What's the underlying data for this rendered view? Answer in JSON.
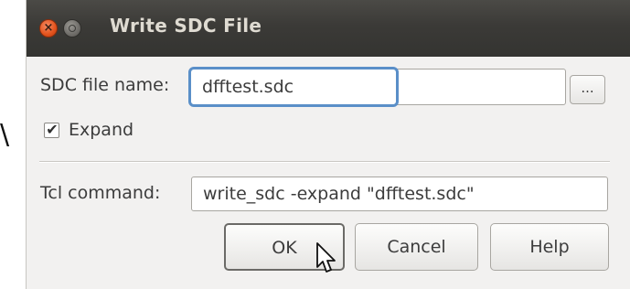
{
  "stray_glyph": "\\",
  "window": {
    "title": "Write SDC File",
    "close_glyph": "×"
  },
  "form": {
    "sdc_label": "SDC file name:",
    "sdc_value": "dfftest.sdc",
    "browse_label": "...",
    "expand_label": "Expand",
    "expand_checked": true,
    "check_glyph": "✔",
    "tcl_label": "Tcl command:",
    "tcl_value": "write_sdc -expand \"dfftest.sdc\""
  },
  "buttons": {
    "ok": "OK",
    "cancel": "Cancel",
    "help": "Help"
  },
  "colors": {
    "titlebar": "#3c3b37",
    "close": "#e2521c",
    "focus": "#5a8fc8"
  },
  "icons": {
    "close": "close-icon",
    "minimize": "minimize-icon",
    "checkbox": "checkmark-icon",
    "cursor": "mouse-pointer-icon"
  }
}
